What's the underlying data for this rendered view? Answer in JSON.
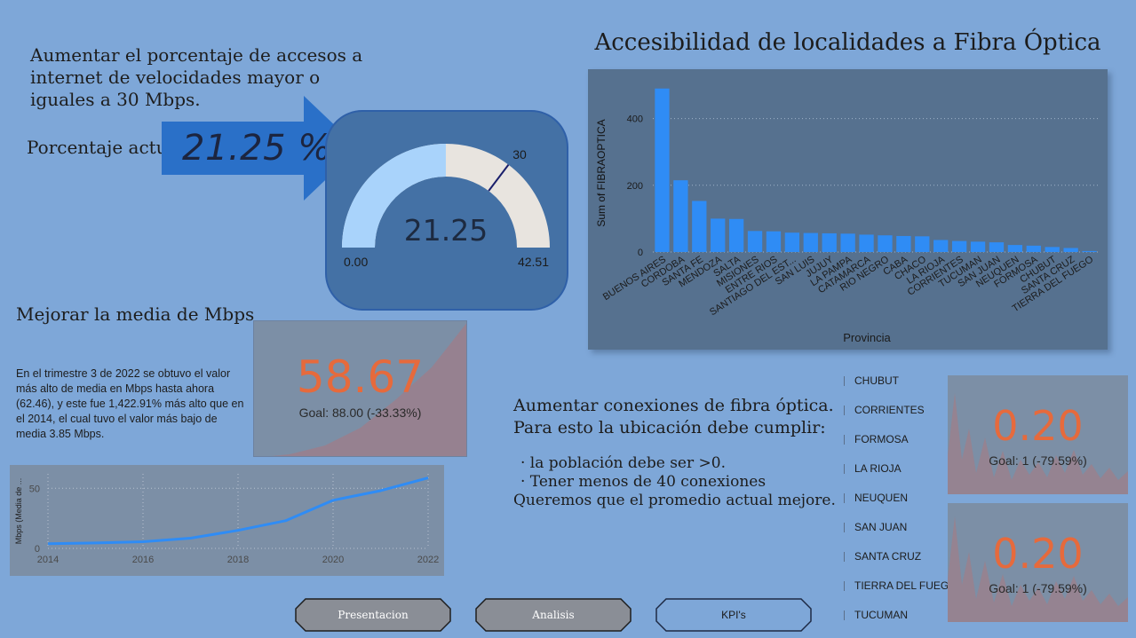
{
  "objective1": {
    "text": "Aumentar el porcentaje de accesos a internet de velocidades mayor o iguales a 30 Mbps.",
    "current_label": "Porcentaje actual:",
    "current_value": "21.25 %"
  },
  "gauge": {
    "value": 21.25,
    "value_label": "21.25",
    "min": 0,
    "min_label": "0.00",
    "max": 42.51,
    "max_label": "42.51",
    "target": 30,
    "target_label": "30",
    "fill_color": "#a9d3fb",
    "track_color": "#e8e4df",
    "card_color": "#4471a5"
  },
  "objective2": {
    "title": "Mejorar la media de Mbps",
    "text": "En el trimestre 3 de 2022 se obtuvo el valor más alto de media en Mbps hasta ahora (62.46), y este fue 1,422.91% más alto que en el 2014, el cual tuvo el valor más bajo de media 3.85 Mbps."
  },
  "kpi_mbps": {
    "value": "58.67",
    "goal": "Goal: 88.00 (-33.33%)",
    "value_color": "#e66a3c"
  },
  "line_chart": {
    "ylabel": "Mbps (Media de ...",
    "x_ticks": [
      "2014",
      "2016",
      "2018",
      "2020",
      "2022"
    ],
    "y_ticks": [
      "0",
      "50"
    ]
  },
  "bar_chart": {
    "title": "Accesibilidad de localidades a Fibra Óptica",
    "xlabel": "Provincia",
    "ylabel": "Sum of FIBRAOPTICA",
    "y_ticks": [
      "0",
      "200",
      "400"
    ]
  },
  "objective3": {
    "title": "Aumentar conexiones de fibra óptica. Para esto la ubicación debe cumplir:",
    "bullets": [
      "· la población debe ser >0.",
      "· Tener menos de 40 conexiones"
    ],
    "closing": "Queremos que el promedio actual mejore."
  },
  "slicer": {
    "items": [
      "CHUBUT",
      "CORRIENTES",
      "FORMOSA",
      "LA RIOJA",
      "NEUQUEN",
      "SAN JUAN",
      "SANTA CRUZ",
      "TIERRA DEL FUEGO",
      "TUCUMAN"
    ]
  },
  "kpi_small": [
    {
      "value": "0.20",
      "goal": "Goal: 1 (-79.59%)"
    },
    {
      "value": "0.20",
      "goal": "Goal: 1 (-79.59%)"
    }
  ],
  "nav": {
    "buttons": [
      "Presentacion",
      "Analisis",
      "KPI's"
    ],
    "active": "KPI's"
  },
  "chart_data": [
    {
      "type": "bar",
      "title": "Accesibilidad de localidades a Fibra Óptica",
      "xlabel": "Provincia",
      "ylabel": "Sum of FIBRAOPTICA",
      "ylim": [
        0,
        500
      ],
      "grid": true,
      "categories": [
        "BUENOS AIRES",
        "CORDOBA",
        "SANTA FE",
        "MENDOZA",
        "SALTA",
        "MISIONES",
        "ENTRE RIOS",
        "SANTIAGO DEL EST...",
        "SAN LUIS",
        "JUJUY",
        "LA PAMPA",
        "CATAMARCA",
        "RIO NEGRO",
        "CABA",
        "CHACO",
        "LA RIOJA",
        "CORRIENTES",
        "TUCUMAN",
        "SAN JUAN",
        "NEUQUEN",
        "FORMOSA",
        "CHUBUT",
        "SANTA CRUZ",
        "TIERRA DEL FUEGO"
      ],
      "values": [
        490,
        215,
        153,
        100,
        99,
        63,
        62,
        58,
        57,
        56,
        55,
        52,
        50,
        48,
        47,
        36,
        33,
        31,
        29,
        21,
        19,
        15,
        12,
        3
      ],
      "color": "#2f8cf5"
    },
    {
      "type": "line",
      "ylabel": "Mbps (Media de ...",
      "x": [
        2014,
        2015,
        2016,
        2017,
        2018,
        2019,
        2020,
        2021,
        2022
      ],
      "values": [
        3.85,
        4.5,
        5.5,
        8.5,
        15,
        23,
        40,
        48,
        58.67
      ],
      "xlim": [
        2014,
        2022
      ],
      "ylim": [
        0,
        62
      ],
      "y_ticks": [
        0,
        50
      ],
      "grid": true,
      "color": "#2f8cf5"
    }
  ]
}
